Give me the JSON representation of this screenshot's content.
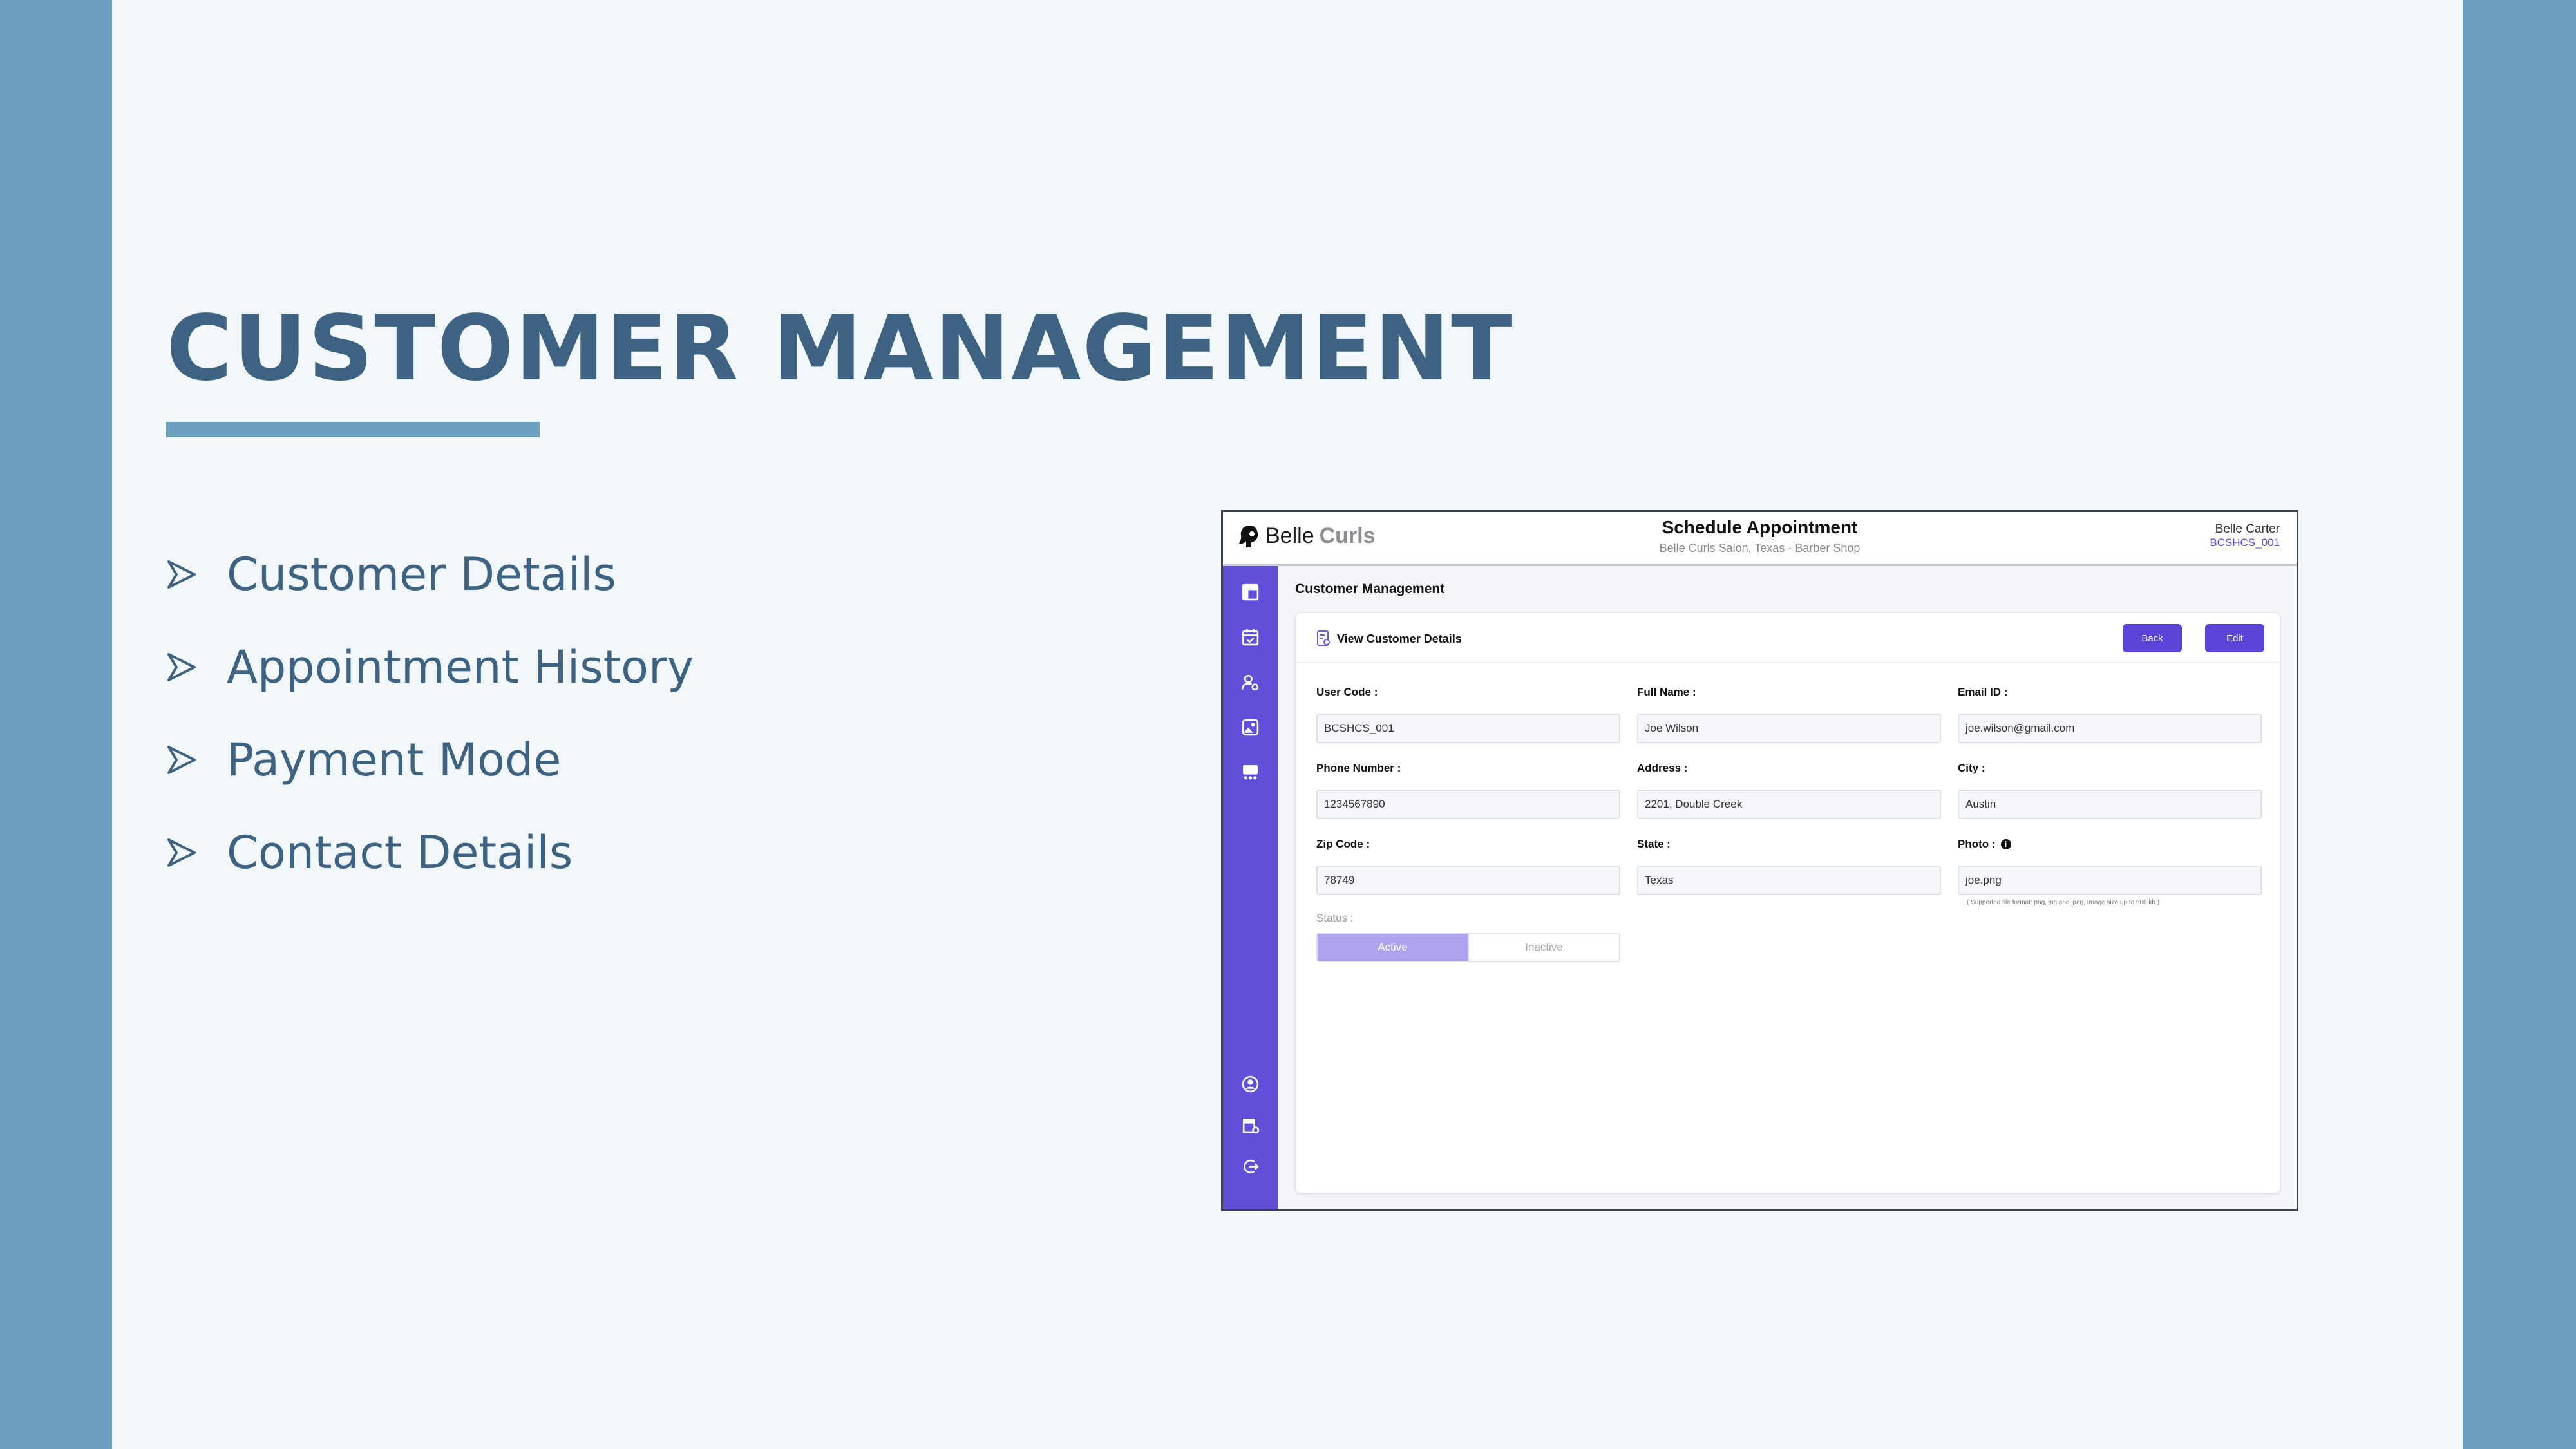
{
  "slide": {
    "title": "CUSTOMER MANAGEMENT",
    "bullets": [
      "Customer Details",
      "Appointment History",
      "Payment Mode",
      "Contact Details"
    ]
  },
  "app": {
    "logo": {
      "first": "Belle",
      "second": "Curls"
    },
    "header": {
      "title": "Schedule Appointment",
      "subtitle": "Belle Curls Salon, Texas - Barber Shop",
      "user_name": "Belle Carter",
      "user_code": "BCSHCS_001"
    },
    "sidebar": {
      "icons": [
        "dashboard-icon",
        "calendar-check-icon",
        "user-settings-icon",
        "gallery-icon",
        "services-icon",
        "profile-icon",
        "store-settings-icon",
        "logout-icon"
      ]
    },
    "page_heading": "Customer Management",
    "card": {
      "title": "View Customer Details",
      "back_label": "Back",
      "edit_label": "Edit"
    },
    "fields": {
      "user_code": {
        "label": "User Code :",
        "value": "BCSHCS_001"
      },
      "full_name": {
        "label": "Full Name :",
        "value": "Joe Wilson"
      },
      "email": {
        "label": "Email ID :",
        "value": "joe.wilson@gmail.com"
      },
      "phone": {
        "label": "Phone Number :",
        "value": "1234567890"
      },
      "address": {
        "label": "Address :",
        "value": "2201, Double Creek"
      },
      "city": {
        "label": "City :",
        "value": "Austin"
      },
      "zip": {
        "label": "Zip Code :",
        "value": "78749"
      },
      "state": {
        "label": "State :",
        "value": "Texas"
      },
      "photo": {
        "label": "Photo :",
        "value": "joe.png",
        "note": "( Supported file format: png, jpg and jpeg, Image size up to 500 kb )"
      }
    },
    "status": {
      "label": "Status :",
      "active": "Active",
      "inactive": "Inactive"
    },
    "colors": {
      "sidebar": "#604fd8",
      "button": "#5b45d9",
      "active_toggle": "#aea3ee",
      "slide_accent": "#3d6282",
      "slide_frame": "#6f9fbf"
    }
  }
}
